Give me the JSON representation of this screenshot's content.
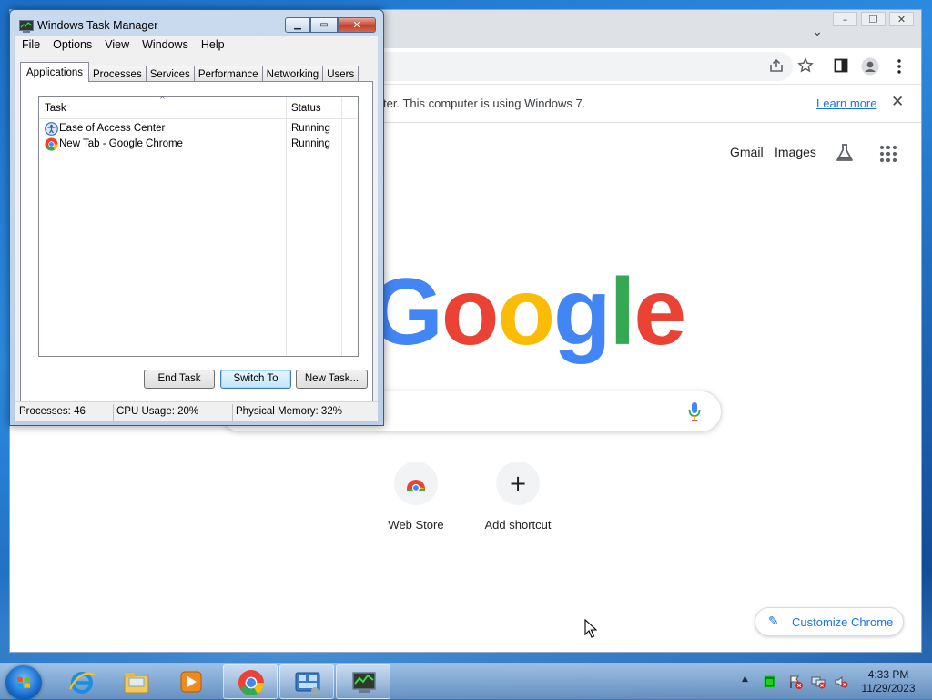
{
  "chrome": {
    "infobar_text": "ter. This computer is using Windows 7.",
    "learn_more": "Learn more",
    "close_glyph": "✕",
    "tab_dropdown": "⌄",
    "window_buttons": [
      "–",
      "❐",
      "✕"
    ],
    "toolbar_icons": [
      "share-icon",
      "star-icon",
      "side-panel-icon",
      "profile-icon",
      "menu-icon"
    ],
    "links": {
      "gmail": "Gmail",
      "images": "Images"
    },
    "logo": [
      {
        "ch": "G",
        "color": "#4285F4"
      },
      {
        "ch": "o",
        "color": "#EA4335"
      },
      {
        "ch": "o",
        "color": "#FBBC05"
      },
      {
        "ch": "g",
        "color": "#4285F4"
      },
      {
        "ch": "l",
        "color": "#34A853"
      },
      {
        "ch": "e",
        "color": "#EA4335"
      }
    ],
    "shortcuts": [
      {
        "label": "Web Store",
        "icon": "web-store-icon"
      },
      {
        "label": "Add shortcut",
        "icon": "plus-icon",
        "glyph": "+"
      }
    ],
    "customize": {
      "label": "Customize Chrome",
      "icon": "pencil-icon",
      "glyph": "✎"
    }
  },
  "taskmgr": {
    "title": "Windows Task Manager",
    "window_buttons": [
      "▁",
      "▭",
      "✕"
    ],
    "menus": [
      "File",
      "Options",
      "View",
      "Windows",
      "Help"
    ],
    "tabs": [
      "Applications",
      "Processes",
      "Services",
      "Performance",
      "Networking",
      "Users"
    ],
    "active_tab": "Applications",
    "columns": {
      "task": "Task",
      "status": "Status",
      "sort_glyph": "^"
    },
    "rows": [
      {
        "task": "Ease of Access Center",
        "status": "Running",
        "icon": "ease-of-access-icon"
      },
      {
        "task": "New Tab - Google Chrome",
        "status": "Running",
        "icon": "chrome-icon"
      }
    ],
    "buttons": {
      "end_task": "End Task",
      "switch_to": "Switch To",
      "new_task": "New Task..."
    },
    "status": {
      "processes": "Processes: 46",
      "cpu": "CPU Usage: 20%",
      "memory": "Physical Memory: 32%"
    }
  },
  "taskbar": {
    "items": [
      "internet-explorer-icon",
      "explorer-icon",
      "media-player-icon",
      "chrome-icon",
      "control-panel-icon",
      "task-manager-icon"
    ],
    "tray_arrow": "▲",
    "clock": {
      "time": "4:33 PM",
      "date": "11/29/2023"
    }
  }
}
